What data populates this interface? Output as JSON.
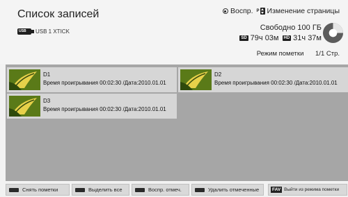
{
  "header": {
    "title": "Список записей",
    "device": "USB 1 XTICK",
    "legend_play": "Воспр.",
    "legend_page": "Изменение страницы",
    "p_key": "P",
    "free_space": "Свободно 100 ГБ",
    "sd_label": "SD",
    "sd_time": "79ч 03м",
    "hd_label": "HD",
    "hd_time": "31ч 37м",
    "mark_mode": "Режим пометки",
    "page": "1/1 Стр."
  },
  "items": [
    {
      "name": "D1",
      "info": "Время проигрывания 00:02:30 /Дата:2010.01.01"
    },
    {
      "name": "D2",
      "info": "Время проигрывания 00:02:30 /Дата:2010.01.01"
    },
    {
      "name": "D3",
      "info": "Время проигрывания 00:02:30 /Дата:2010.01.01"
    }
  ],
  "footer": {
    "unmark": "Снять пометки",
    "select_all": "Выделить все",
    "play_marked": "Воспр. отмеч.",
    "delete_marked": "Удалить отмеченные",
    "fav_key": "FAV",
    "exit_mark": "Выйти из режима пометки"
  },
  "colors": {
    "list_background": "#a6a6a6",
    "item_background": "#d6d6d6",
    "thumbnail_green": "#5a7a18",
    "thumbnail_yellow": "#e7d14a"
  }
}
